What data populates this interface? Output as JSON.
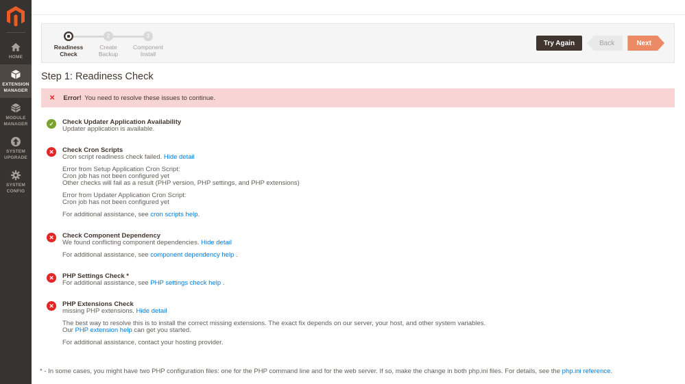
{
  "colors": {
    "sidebar_dark": "#373330",
    "sidebar_active": "#4e4742",
    "logo_orange": "#ea5b26",
    "accent_next_orange": "#eb8a64",
    "button_dark": "#41362f",
    "success_green": "#79a22e",
    "error_red": "#e22626",
    "banner_pink": "#f9d4d4",
    "link_blue": "#007bdb"
  },
  "icons": {
    "check": "✓",
    "cross": "✕"
  },
  "sidebar": {
    "items": [
      {
        "label": "HOME"
      },
      {
        "label": "EXTENSION MANAGER"
      },
      {
        "label": "MODULE MANAGER"
      },
      {
        "label": "SYSTEM UPGRADE"
      },
      {
        "label": "SYSTEM CONFIG"
      }
    ]
  },
  "stepper": {
    "steps": [
      {
        "label": "Readiness Check",
        "number": ""
      },
      {
        "label": "Create Backup",
        "number": "2"
      },
      {
        "label": "Component Install",
        "number": "3"
      }
    ]
  },
  "toolbar": {
    "try_again_label": "Try Again",
    "back_label": "Back",
    "next_label": "Next"
  },
  "page": {
    "title": "Step 1: Readiness Check"
  },
  "error_banner": {
    "prefix": "Error!",
    "message": " You need to resolve these issues to continue."
  },
  "checks": {
    "updater": {
      "title": "Check Updater Application Availability",
      "description": "Updater application is available."
    },
    "cron": {
      "title": "Check Cron Scripts",
      "status": "Cron script readiness check failed. ",
      "detail_link": "Hide detail",
      "detail_line1": "Error from Setup Application Cron Script:",
      "detail_line2": "Cron job has not been configured yet",
      "detail_line3": "Other checks will fail as a result (PHP version, PHP settings, and PHP extensions)",
      "detail_line4": "Error from Updater Application Cron Script:",
      "detail_line5": "Cron job has not been configured yet",
      "assist_prefix": "For additional assistance, see ",
      "assist_link": "cron scripts help",
      "assist_suffix": "."
    },
    "dependency": {
      "title": "Check Component Dependency",
      "status": "We found conflicting component dependencies. ",
      "detail_link": "Hide detail",
      "assist_prefix": "For additional assistance, see ",
      "assist_link": "component dependency help",
      "assist_suffix": " ."
    },
    "php_settings": {
      "title": "PHP Settings Check *",
      "assist_prefix": "For additional assistance, see ",
      "assist_link": "PHP settings check help",
      "assist_suffix": " ."
    },
    "php_extensions": {
      "title": "PHP Extensions Check",
      "status": "missing PHP extensions. ",
      "detail_link": "Hide detail",
      "resolve_text": "The best way to resolve this is to install the correct missing extensions. The exact fix depends on our server, your host, and other system variables.",
      "help_prefix": "Our ",
      "help_link": "PHP extension help",
      "help_suffix": " can get you started.",
      "assist_text": "For additional assistance, contact your hosting provider."
    }
  },
  "footnote": {
    "text_before": "* - In some cases, you might have two PHP configuration files: one for the PHP command line and for the web server. If so, make the change in both php.ini files. For details, see the ",
    "link": "php.ini reference",
    "text_after": "."
  }
}
